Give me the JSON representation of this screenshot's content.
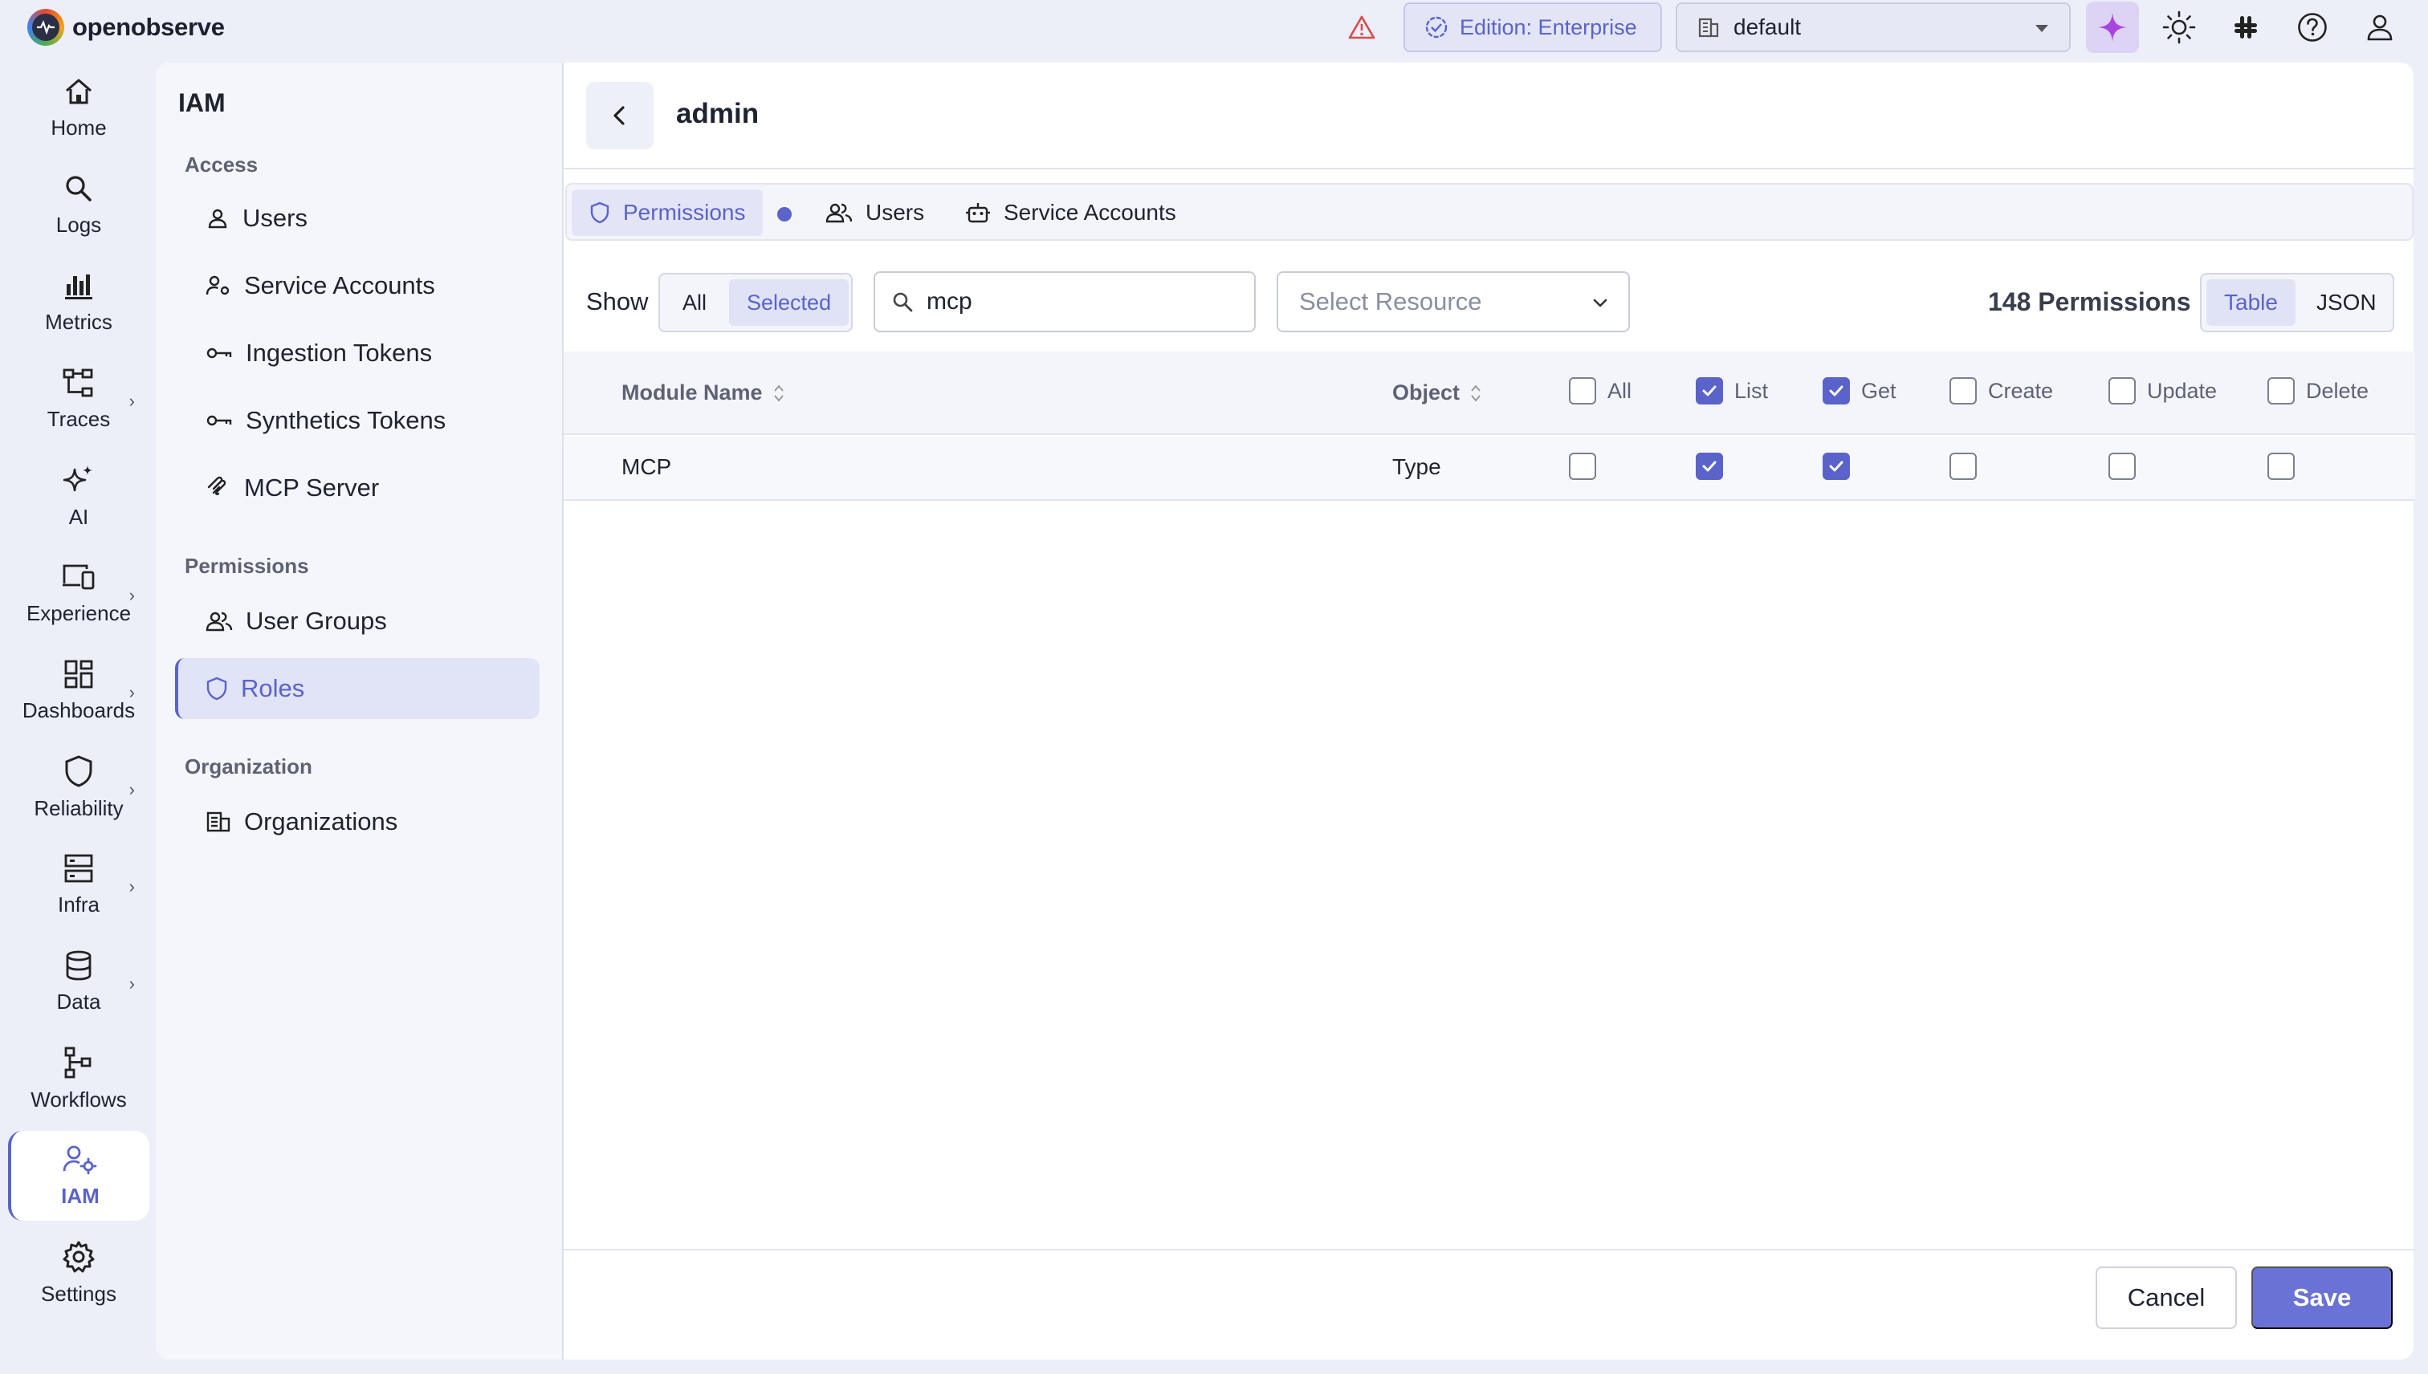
{
  "app": {
    "name": "openobserve"
  },
  "topbar": {
    "edition_label": "Edition: Enterprise",
    "org_selected": "default"
  },
  "rail": {
    "items": [
      {
        "label": "Home",
        "icon": "home-icon"
      },
      {
        "label": "Logs",
        "icon": "search-icon"
      },
      {
        "label": "Metrics",
        "icon": "bar-chart-icon"
      },
      {
        "label": "Traces",
        "icon": "traces-icon"
      },
      {
        "label": "AI",
        "icon": "sparkle-icon"
      },
      {
        "label": "Experience",
        "icon": "devices-icon"
      },
      {
        "label": "Dashboards",
        "icon": "dashboard-icon"
      },
      {
        "label": "Reliability",
        "icon": "shield-icon"
      },
      {
        "label": "Infra",
        "icon": "server-icon"
      },
      {
        "label": "Data",
        "icon": "database-icon"
      },
      {
        "label": "Workflows",
        "icon": "workflow-icon"
      },
      {
        "label": "IAM",
        "icon": "user-gear-icon"
      },
      {
        "label": "Settings",
        "icon": "gear-icon"
      }
    ]
  },
  "iam": {
    "title": "IAM",
    "sections": {
      "access": "Access",
      "permissions": "Permissions",
      "organization": "Organization"
    },
    "items": {
      "users": "Users",
      "service_accounts": "Service Accounts",
      "ingestion_tokens": "Ingestion Tokens",
      "synthetics_tokens": "Synthetics Tokens",
      "mcp_server": "MCP Server",
      "user_groups": "User Groups",
      "roles": "Roles",
      "organizations": "Organizations"
    }
  },
  "main": {
    "title": "admin",
    "tabs": {
      "permissions": "Permissions",
      "users": "Users",
      "service_accounts": "Service Accounts"
    },
    "filters": {
      "show_label": "Show",
      "show_all": "All",
      "show_selected": "Selected",
      "search_value": "mcp",
      "resource_placeholder": "Select Resource"
    },
    "permission_count": "148 Permissions",
    "view": {
      "table": "Table",
      "json": "JSON"
    },
    "table": {
      "col_module": "Module Name",
      "col_object": "Object",
      "col_all": "All",
      "col_list": "List",
      "col_get": "Get",
      "col_create": "Create",
      "col_update": "Update",
      "col_delete": "Delete",
      "header_checked": {
        "all": false,
        "list": true,
        "get": true,
        "create": false,
        "update": false,
        "delete": false
      },
      "rows": [
        {
          "module": "MCP",
          "object": "Type",
          "checked": {
            "all": false,
            "list": true,
            "get": true,
            "create": false,
            "update": false,
            "delete": false
          }
        }
      ]
    },
    "footer": {
      "cancel": "Cancel",
      "save": "Save"
    }
  },
  "colors": {
    "accent": "#5a63c9",
    "save_bg": "#6b72d6"
  }
}
